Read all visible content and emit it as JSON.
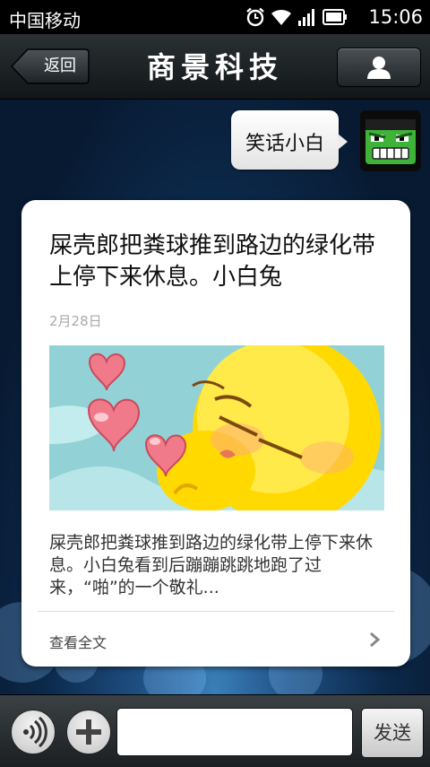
{
  "status_bar": {
    "carrier": "中国移动",
    "time": "15:06",
    "icons": [
      "alarm-icon",
      "wifi-icon",
      "signal-icon",
      "battery-icon"
    ]
  },
  "header": {
    "back_label": "返回",
    "title": "商景科技",
    "profile_icon": "person-icon"
  },
  "chat": {
    "sent_message": "笑话小白",
    "user_avatar": "green-monster-avatar",
    "article": {
      "title": "屎壳郎把粪球推到路边的绿化带上停下来休息。小白兔",
      "date": "2月28日",
      "image": "yellow-chick-hearts-illustration",
      "summary": "屎壳郎把粪球推到路边的绿化带上停下来休息。小白兔看到后蹦蹦跳跳地跑了过来，“啪”的一个敬礼...",
      "read_more_label": "查看全文"
    }
  },
  "input_bar": {
    "voice_icon": "voice-icon",
    "plus_icon": "plus-icon",
    "input_value": "",
    "input_placeholder": "",
    "send_label": "发送"
  },
  "colors": {
    "title_bar": "#1a1f22",
    "chat_background": "#0c2a4c",
    "card": "#ffffff"
  }
}
